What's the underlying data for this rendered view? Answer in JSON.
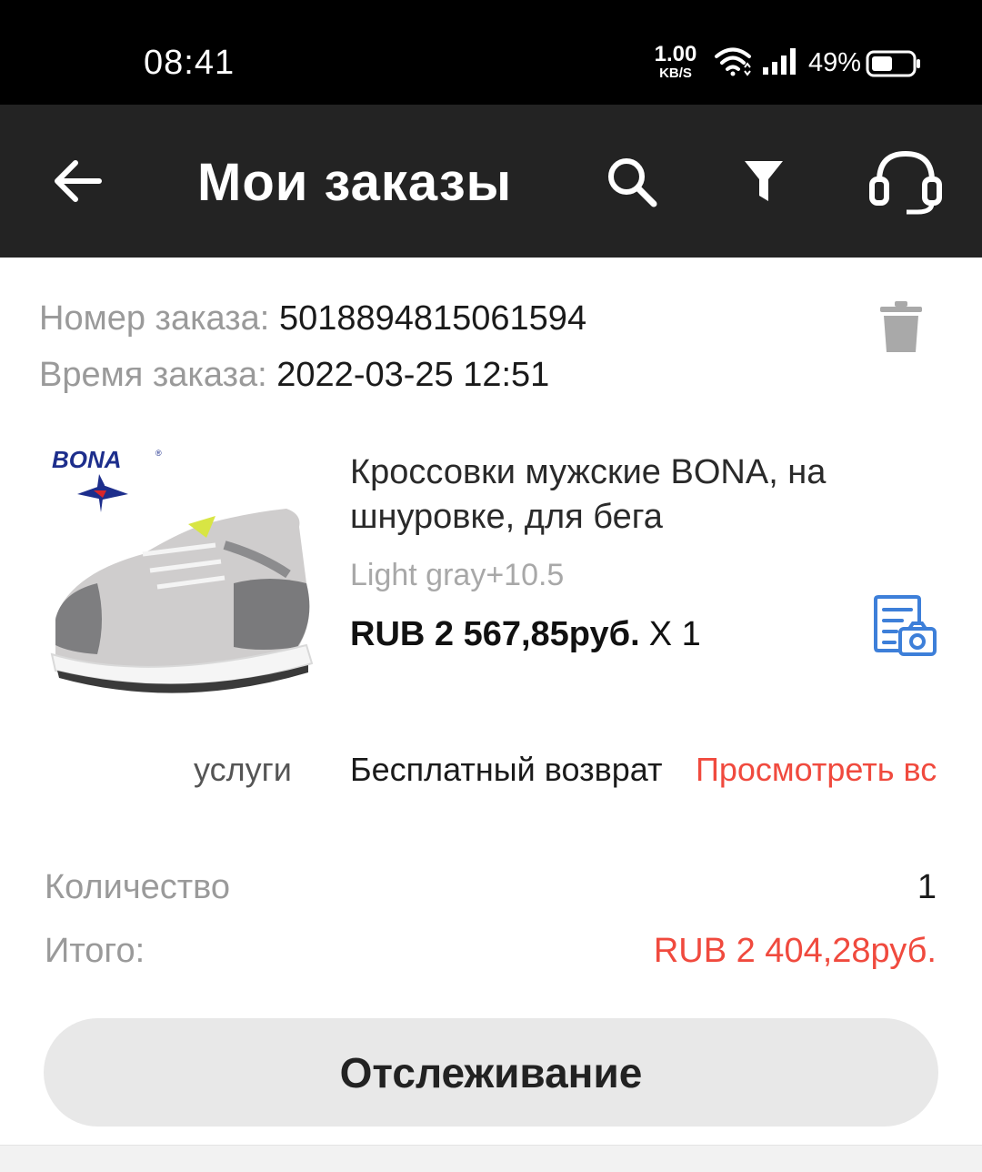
{
  "status_bar": {
    "time": "08:41",
    "net_speed_value": "1.00",
    "net_speed_unit": "KB/S",
    "battery_percent": "49%",
    "icons": [
      "wifi-icon",
      "signal-icon",
      "battery-icon"
    ]
  },
  "toolbar": {
    "title": "Мои заказы",
    "icons": [
      "back-arrow-icon",
      "search-icon",
      "filter-icon",
      "headset-icon"
    ]
  },
  "order": {
    "number_label": "Номер заказа:",
    "number_value": "5018894815061594",
    "time_label": "Время заказа:",
    "time_value": "2022-03-25 12:51",
    "product": {
      "title": "Кроссовки мужские BONA, на шнуровке, для бега",
      "variant": "Light gray+10.5",
      "price": "RUB 2 567,85руб.",
      "quantity": "X 1",
      "brand_logo_text": "BONA"
    },
    "service": {
      "label": "услуги",
      "value": "Бесплатный возврат",
      "link": "Просмотреть все"
    },
    "summary": {
      "quantity_label": "Количество",
      "quantity_value": "1",
      "total_label": "Итого:",
      "total_value": "RUB 2 404,28руб."
    },
    "track_button": "Отслеживание"
  },
  "colors": {
    "status_bar_bg": "#000000",
    "toolbar_bg": "#232323",
    "accent_red": "#f04a3e",
    "icon_blue": "#3d7fd9",
    "button_bg": "#e8e8e8"
  }
}
